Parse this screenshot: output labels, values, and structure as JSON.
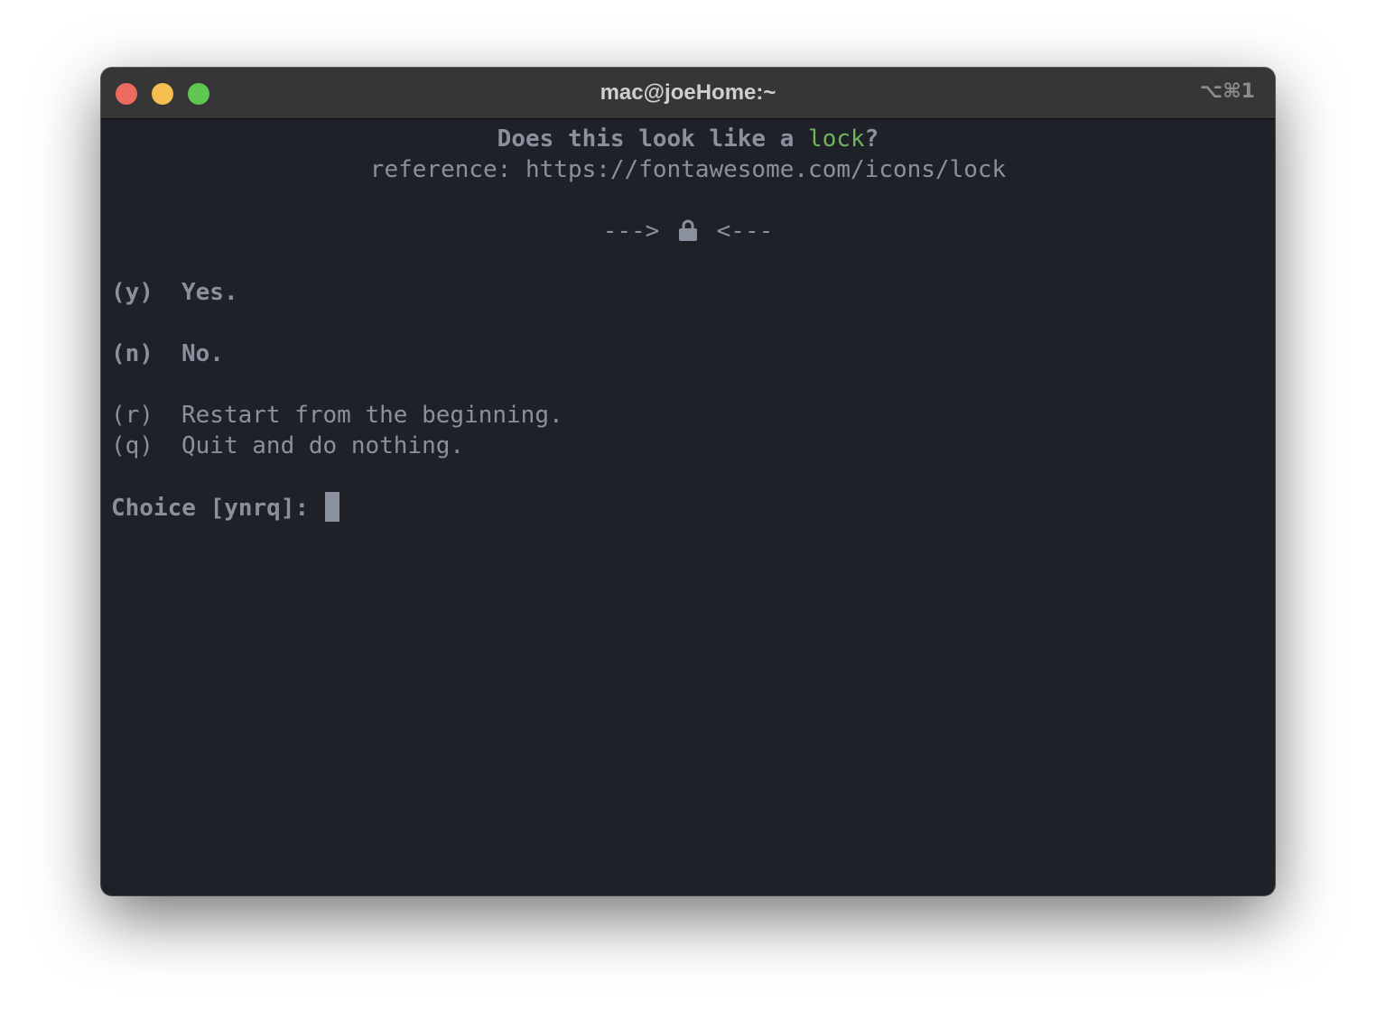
{
  "window": {
    "title": "mac@joeHome:~",
    "shortcut": "⌥⌘1"
  },
  "terminal": {
    "question_prefix": "Does this look like a ",
    "question_word": "lock",
    "question_suffix": "?",
    "reference": "reference: https://fontawesome.com/icons/lock",
    "arrow_left": "--->",
    "arrow_right": "<---",
    "icon": "lock-icon",
    "options": [
      {
        "key": "(y)",
        "label": "Yes."
      },
      {
        "key": "(n)",
        "label": "No."
      },
      {
        "key": "(r)",
        "label": "Restart from the beginning."
      },
      {
        "key": "(q)",
        "label": "Quit and do nothing."
      }
    ],
    "prompt": "Choice [ynrq]: "
  },
  "colors": {
    "background": "#1f2128",
    "text": "#8a919e",
    "highlight": "#6fb35a",
    "titlebar": "#363636"
  }
}
